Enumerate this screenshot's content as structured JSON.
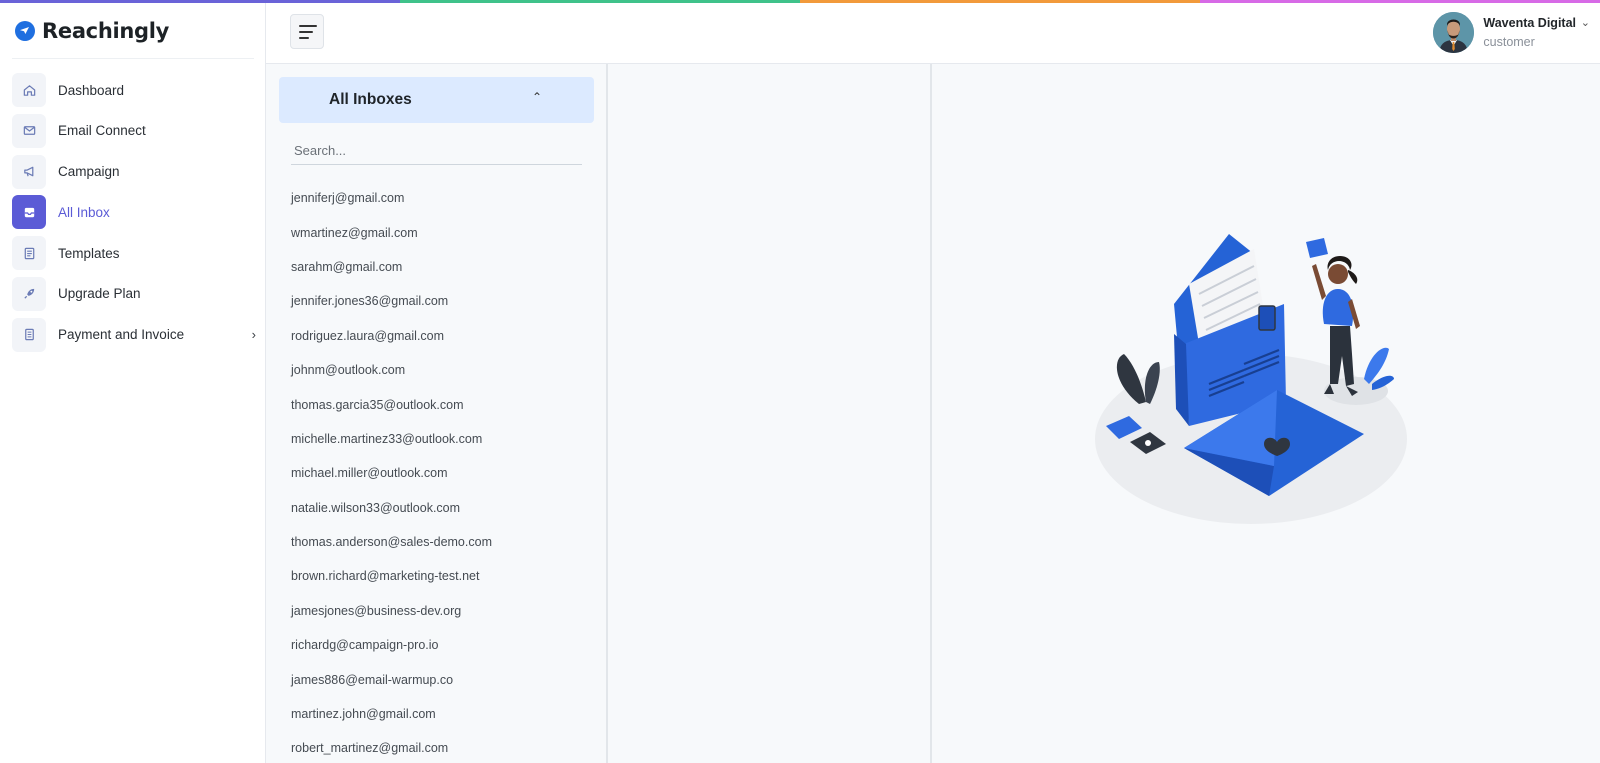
{
  "colors": {
    "accent": "#5b5bd6",
    "brand": "#1f6fe0",
    "stripe": [
      "#6a63d8",
      "#3fc28a",
      "#f29a3b",
      "#d76ae6"
    ],
    "inbox_header_bg": "#dceaff"
  },
  "app": {
    "logo_icon": "paper-plane-icon",
    "name": "Reachingly"
  },
  "sidebar": {
    "items": [
      {
        "label": "Dashboard",
        "icon": "home-icon",
        "active": false
      },
      {
        "label": "Email Connect",
        "icon": "mail-icon",
        "active": false
      },
      {
        "label": "Campaign",
        "icon": "megaphone-icon",
        "active": false
      },
      {
        "label": "All Inbox",
        "icon": "inbox-icon",
        "active": true
      },
      {
        "label": "Templates",
        "icon": "document-icon",
        "active": false
      },
      {
        "label": "Upgrade Plan",
        "icon": "rocket-icon",
        "active": false
      },
      {
        "label": "Payment and Invoice",
        "icon": "receipt-icon",
        "active": false,
        "has_submenu": true
      }
    ]
  },
  "header": {
    "menu_icon": "menu-icon",
    "user": {
      "name": "Waventa Digital",
      "role": "customer"
    }
  },
  "inbox": {
    "title": "All Inboxes",
    "search_placeholder": "Search...",
    "accounts": [
      "jenniferj@gmail.com",
      "wmartinez@gmail.com",
      "sarahm@gmail.com",
      "jennifer.jones36@gmail.com",
      "rodriguez.laura@gmail.com",
      "johnm@outlook.com",
      "thomas.garcia35@outlook.com",
      "michelle.martinez33@outlook.com",
      "michael.miller@outlook.com",
      "natalie.wilson33@outlook.com",
      "thomas.anderson@sales-demo.com",
      "brown.richard@marketing-test.net",
      "jamesjones@business-dev.org",
      "richardg@campaign-pro.io",
      "james886@email-warmup.co",
      "martinez.john@gmail.com",
      "robert_martinez@gmail.com"
    ]
  }
}
